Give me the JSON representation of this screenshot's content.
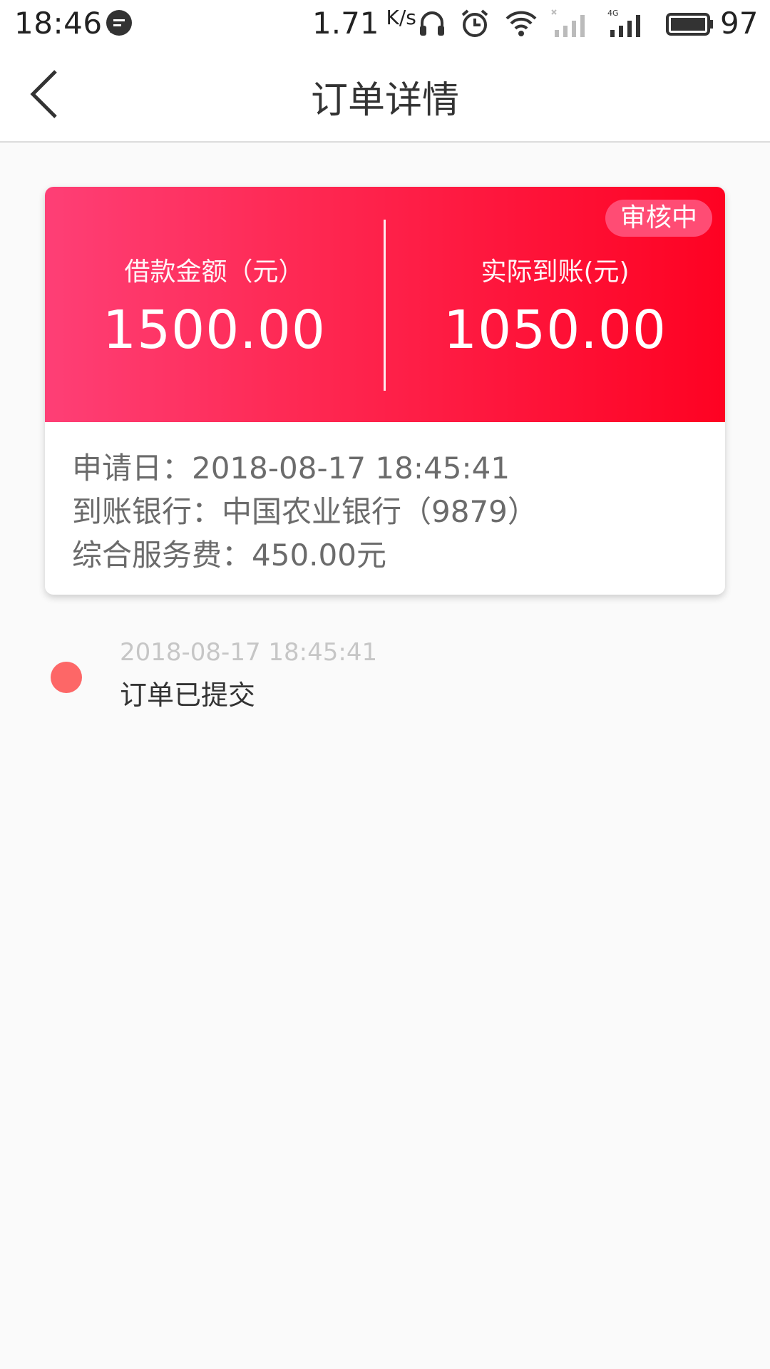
{
  "status_bar": {
    "time": "18:46",
    "net_speed": "1.71",
    "net_speed_unit": "K/s",
    "battery": "97",
    "icons": [
      "message-icon",
      "headset-icon",
      "alarm-icon",
      "wifi-icon",
      "signal-icon",
      "signal-4g-icon",
      "battery-icon"
    ]
  },
  "nav": {
    "title": "订单详情",
    "back_icon": "chevron-left-icon"
  },
  "order_card": {
    "status_badge": "审核中",
    "loan_amount_label": "借款金额（元）",
    "loan_amount": "1500.00",
    "actual_received_label": "实际到账(元)",
    "actual_received": "1050.00",
    "apply_date": "申请日：2018-08-17 18:45:41",
    "bank": "到账银行：中国农业银行（9879）",
    "service_fee": "综合服务费：450.00元",
    "colors": {
      "gradient_start": "#fe3f76",
      "gradient_end": "#fe0222"
    }
  },
  "timeline": [
    {
      "time": "2018-08-17 18:45:41",
      "text": "订单已提交",
      "dot_color": "#fd6767"
    }
  ]
}
